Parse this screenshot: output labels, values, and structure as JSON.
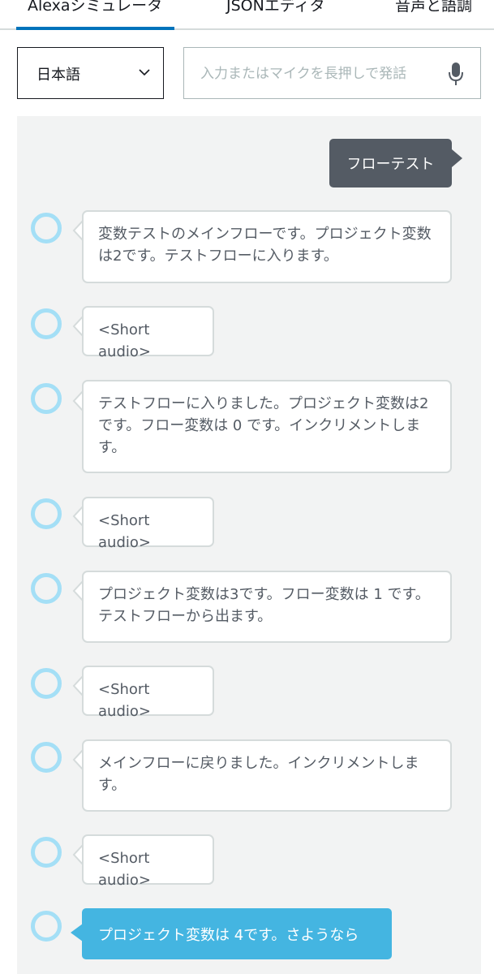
{
  "tabs": [
    {
      "label": "Alexaシミュレータ"
    },
    {
      "label": "JSONエディタ"
    },
    {
      "label": "音声と語調"
    }
  ],
  "locale": {
    "selected": "日本語"
  },
  "utterance": {
    "placeholder": "入力またはマイクを長押しで発話"
  },
  "user_message": "フローテスト",
  "alexa_messages": [
    "変数テストのメインフローです。プロジェクト変数は2です。テストフローに入ります。",
    "<Short audio>",
    "テストフローに入りました。プロジェクト変数は2です。フロー変数は 0 です。インクリメントします。",
    "<Short audio>",
    "プロジェクト変数は3です。フロー変数は 1 です。テストフローから出ます。",
    "<Short audio>",
    "メインフローに戻りました。インクリメントします。",
    "<Short audio>"
  ],
  "final_message": "プロジェクト変数は 4です。さようなら",
  "colors": {
    "accent": "#0073bb",
    "user_bubble": "#545b64",
    "alexa_ring": "#a4dff6",
    "final_bubble": "#44b5e1"
  }
}
